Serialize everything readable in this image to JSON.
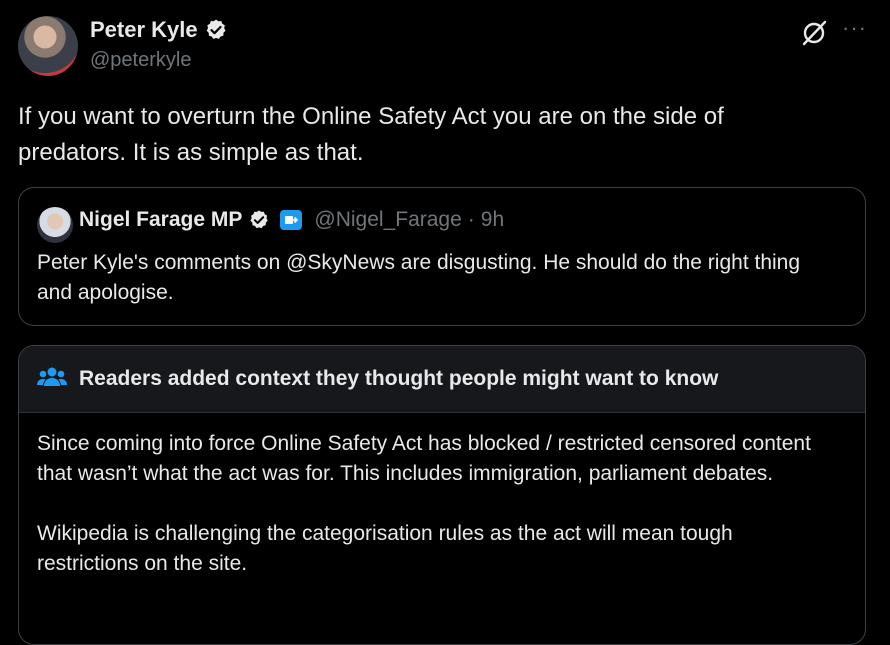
{
  "author": {
    "display_name": "Peter Kyle",
    "handle": "@peterkyle"
  },
  "icons": {
    "verified": "verified-badge-icon",
    "grok": "grok-icon",
    "more": "more-icon",
    "affiliation": "affiliation-badge-icon",
    "community": "people-icon"
  },
  "colors": {
    "background": "#000000",
    "text": "#e7e9ea",
    "muted": "#71767b",
    "accent": "#1d9bf0",
    "border": "#3d4145"
  },
  "tweet": {
    "text": "If you want to overturn the Online Safety Act you are on the side of predators. It is as simple as that."
  },
  "quote": {
    "display_name": "Nigel Farage MP",
    "handle": "@Nigel_Farage",
    "separator": "·",
    "time": "9h",
    "text": "Peter Kyle's comments on @SkyNews are disgusting. He should do the right thing and apologise."
  },
  "community_note": {
    "title": "Readers added context they thought people might want to know",
    "paragraphs": [
      "Since coming into force Online Safety Act has blocked / restricted censored content that wasn’t what the act was for. This includes immigration, parliament debates.",
      "Wikipedia is challenging the categorisation rules as the act will mean tough restrictions on the site."
    ]
  }
}
